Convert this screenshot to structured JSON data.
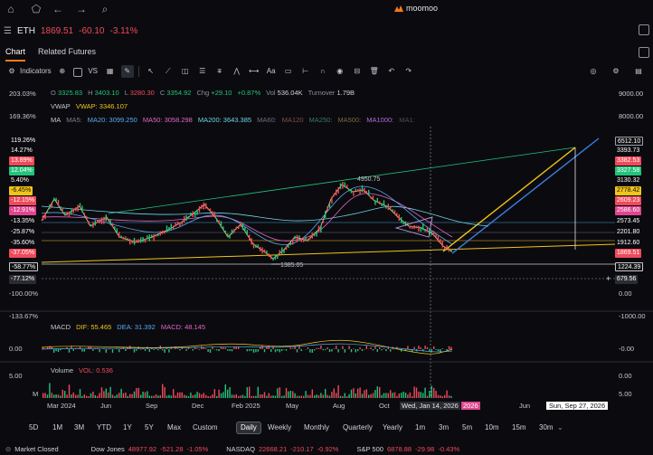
{
  "brand": {
    "name": "moomoo"
  },
  "quote": {
    "symbol": "ETH",
    "price": "1869.51",
    "change": "-60.10",
    "change_pct": "-3.11%"
  },
  "tabs": [
    {
      "label": "Chart"
    },
    {
      "label": "Related Futures"
    }
  ],
  "toolbar": {
    "indicators_label": "Indicators",
    "vs_label": "VS",
    "text_label": "Aa"
  },
  "ohlc": {
    "o_label": "O",
    "o": "3325.83",
    "h_label": "H",
    "h": "3403.10",
    "l_label": "L",
    "l": "3280.30",
    "c_label": "C",
    "c": "3354.92",
    "chg_label": "Chg",
    "chg": "+29.10",
    "chg_pct": "+0.87%",
    "vol_label": "Vol",
    "vol": "536.04K",
    "turnover_label": "Turnover",
    "turnover": "1.79B"
  },
  "vwap": {
    "label": "VWAP",
    "value": "VWAP: 3346.107"
  },
  "ma": {
    "label": "MA",
    "items": [
      "MA5:",
      "MA20: 3099.250",
      "MA50: 3058.298",
      "MA200: 3643.385",
      "MA60:",
      "MA120",
      "MA250:",
      "MA500:",
      "MA1000:",
      "MA1:"
    ]
  },
  "left_axis": {
    "labels": [
      "203.03%",
      "169.36%",
      "119.26%",
      "14.27%",
      "13.89%",
      "12.04%",
      "5.40%",
      "-6.45%",
      "-12.15%",
      "-12.91%",
      "-13.35%",
      "-25.87%",
      "-35.60%",
      "-37.05%",
      "-58.77%",
      "-77.12%",
      "-100.00%",
      "-133.67%"
    ]
  },
  "right_axis": {
    "labels": [
      "9000.00",
      "8000.00",
      "6512.10",
      "3393.73",
      "3382.53",
      "3327.58",
      "3130.32",
      "2778.42",
      "2609.23",
      "2586.60",
      "2573.45",
      "2201.80",
      "1912.60",
      "1869.51",
      "1224.39",
      "679.56",
      "0.00",
      "-1000.00"
    ]
  },
  "annotations": {
    "high": "4950.75",
    "low": "1385.05"
  },
  "macd": {
    "title": "MACD",
    "dif": "DIF: 55.465",
    "dea": "DEA: 31.392",
    "macd": "MACD: 48.145",
    "axis": [
      "0.00",
      "-0.00"
    ]
  },
  "volume": {
    "title": "Volume",
    "vol": "VOL: 0.536",
    "axis": [
      "5.00",
      "0.00",
      "5.00",
      "M"
    ]
  },
  "x_axis": {
    "labels": [
      "Mar 2024",
      "Jun",
      "Sep",
      "Dec",
      "Feb 2025",
      "May",
      "Aug",
      "Oct",
      "Wed, Jan 14, 2026",
      "2026",
      "Jun",
      "Sun, Sep 27, 2026"
    ]
  },
  "timeframes": [
    "5D",
    "1M",
    "3M",
    "YTD",
    "1Y",
    "5Y",
    "Max",
    "Custom",
    "Daily",
    "Weekly",
    "Monthly",
    "Quarterly",
    "Yearly",
    "1m",
    "3m",
    "5m",
    "10m",
    "15m",
    "30m"
  ],
  "footer": {
    "status": "Market Closed",
    "dj_label": "Dow Jones",
    "dj_val": "48977.92",
    "dj_chg": "-521.28",
    "dj_pct": "-1.05%",
    "nq_label": "NASDAQ",
    "nq_val": "22668.21",
    "nq_chg": "-210.17",
    "nq_pct": "-0.92%",
    "sp_label": "S&P 500",
    "sp_val": "6878.88",
    "sp_chg": "-29.98",
    "sp_pct": "-0.43%"
  },
  "colors": {
    "up": "#22c37a",
    "down": "#f04a5a",
    "accent": "#ff7a1a",
    "gold": "#f0c419",
    "blue": "#3d7ee8"
  }
}
